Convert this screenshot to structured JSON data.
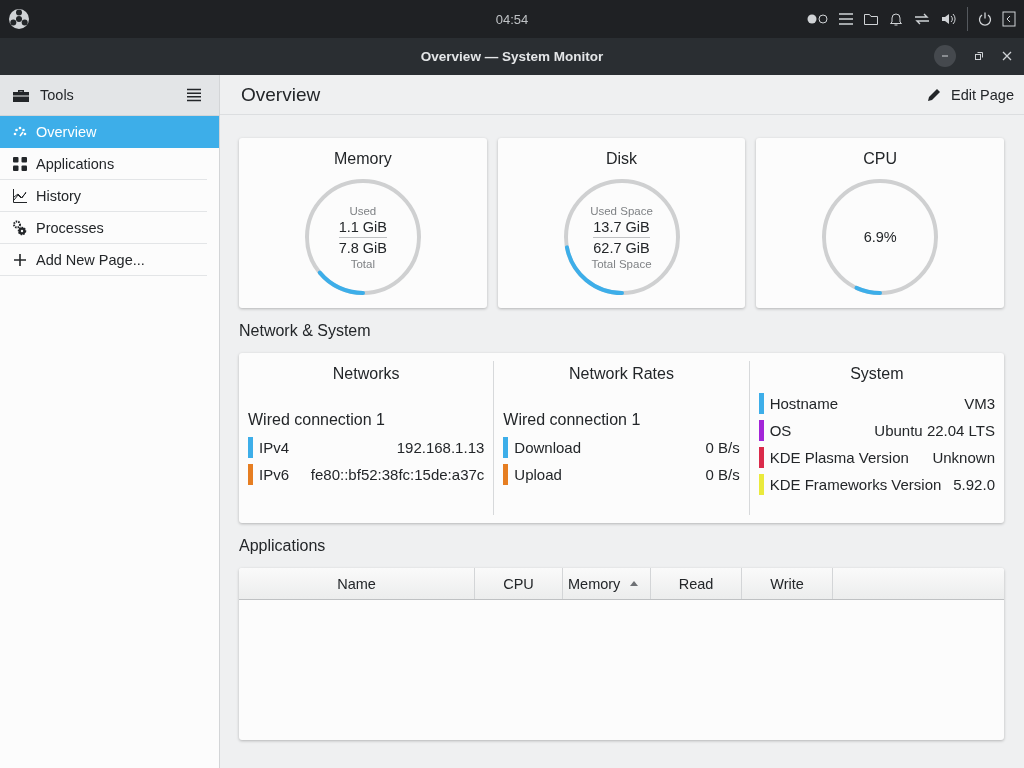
{
  "panel": {
    "clock": "04:54"
  },
  "window": {
    "title": "Overview — System Monitor"
  },
  "sidebar": {
    "title": "Tools",
    "items": [
      {
        "label": "Overview",
        "selected": true
      },
      {
        "label": "Applications",
        "selected": false
      },
      {
        "label": "History",
        "selected": false
      },
      {
        "label": "Processes",
        "selected": false
      },
      {
        "label": "Add New Page...",
        "selected": false
      }
    ]
  },
  "page": {
    "title": "Overview",
    "edit_button": "Edit Page"
  },
  "gauges": [
    {
      "title": "Memory",
      "top_label": "Used",
      "top_value": "1.1 GiB",
      "bottom_value": "7.8 GiB",
      "bottom_label": "Total",
      "level": 0.14
    },
    {
      "title": "Disk",
      "top_label": "Used Space",
      "top_value": "13.7 GiB",
      "bottom_value": "62.7 GiB",
      "bottom_label": "Total Space",
      "level": 0.22
    },
    {
      "title": "CPU",
      "value": "6.9%",
      "level": 0.069
    }
  ],
  "network_section": {
    "title": "Network & System",
    "columns": [
      {
        "title": "Networks",
        "subtitle": "Wired connection 1",
        "rows": [
          {
            "label": "IPv4",
            "value": "192.168.1.13",
            "color": "#3daee9"
          },
          {
            "label": "IPv6",
            "value": "fe80::bf52:38fc:15de:a37c",
            "color": "#e67e22"
          }
        ]
      },
      {
        "title": "Network Rates",
        "subtitle": "Wired connection 1",
        "rows": [
          {
            "label": "Download",
            "value": "0 B/s",
            "color": "#3daee9"
          },
          {
            "label": "Upload",
            "value": "0 B/s",
            "color": "#e67e22"
          }
        ]
      },
      {
        "title": "System",
        "rows": [
          {
            "label": "Hostname",
            "value": "VM3",
            "color": "#3daee9"
          },
          {
            "label": "OS",
            "value": "Ubuntu 22.04 LTS",
            "color": "#a325d8"
          },
          {
            "label": "KDE Plasma Version",
            "value": "Unknown",
            "color": "#da2a4a"
          },
          {
            "label": "KDE Frameworks Version",
            "value": "5.92.0",
            "color": "#eaea3c"
          }
        ]
      }
    ]
  },
  "applications": {
    "title": "Applications",
    "columns": [
      {
        "label": "Name",
        "sorted": false
      },
      {
        "label": "CPU",
        "sorted": false
      },
      {
        "label": "Memory",
        "sorted": true
      },
      {
        "label": "Read",
        "sorted": false
      },
      {
        "label": "Write",
        "sorted": false
      }
    ]
  }
}
